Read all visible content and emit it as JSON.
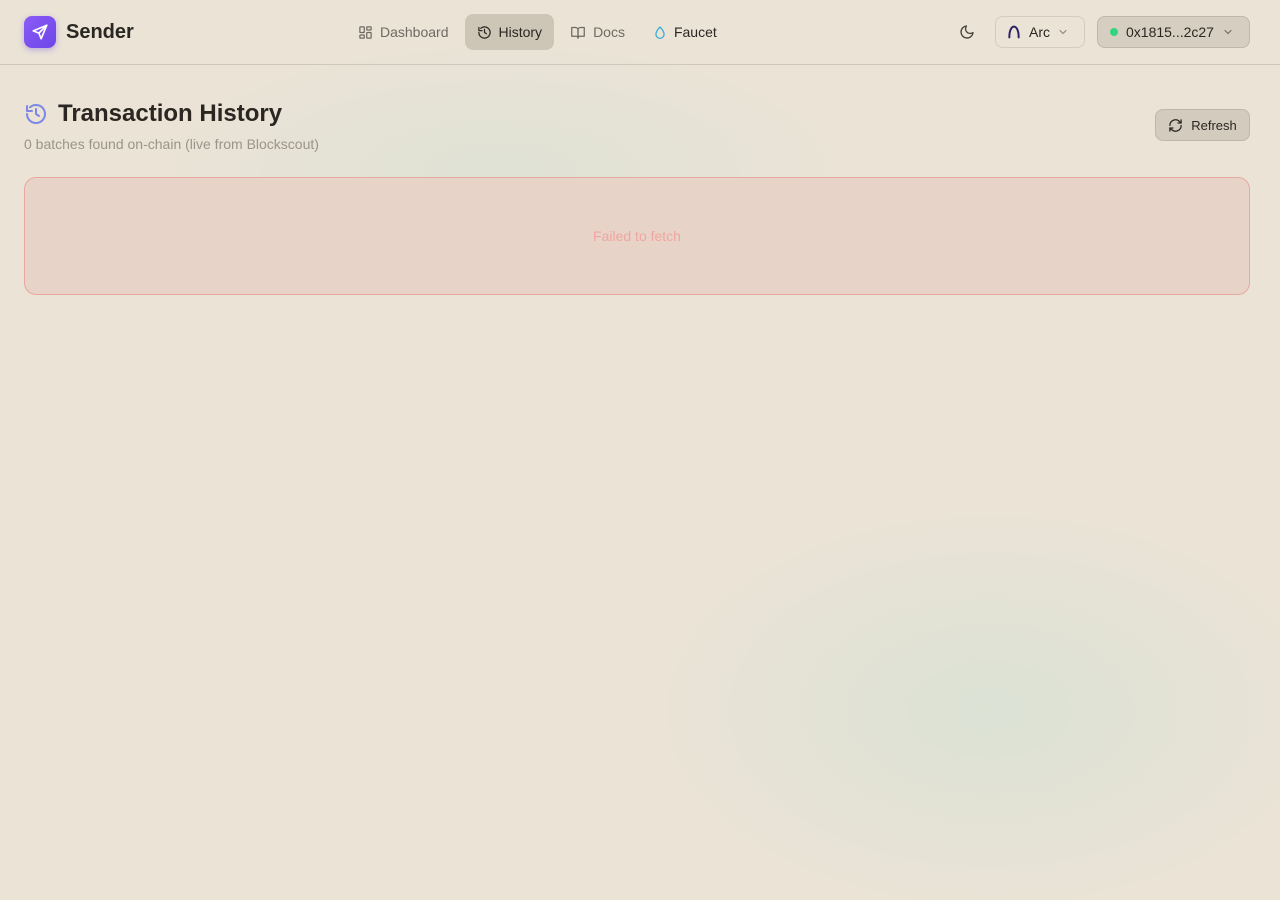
{
  "brand": {
    "name": "Sender"
  },
  "nav": {
    "items": [
      {
        "label": "Dashboard",
        "icon": "dashboard-grid-icon",
        "active": false
      },
      {
        "label": "History",
        "icon": "history-icon",
        "active": true
      },
      {
        "label": "Docs",
        "icon": "book-icon",
        "active": false
      },
      {
        "label": "Faucet",
        "icon": "droplet-icon",
        "active": false
      }
    ]
  },
  "header": {
    "network": {
      "label": "Arc"
    },
    "wallet": {
      "address": "0x1815...2c27",
      "status_color": "#34d37f"
    }
  },
  "page": {
    "title": "Transaction History",
    "subtitle": "0 batches found on-chain (live from Blockscout)",
    "refresh_label": "Refresh",
    "error_message": "Failed to fetch"
  },
  "colors": {
    "accent": "#7c4ef0",
    "error_border": "#e7a8a1",
    "error_text": "#f0a6a0",
    "active_nav_bg": "#cdc5b6"
  }
}
